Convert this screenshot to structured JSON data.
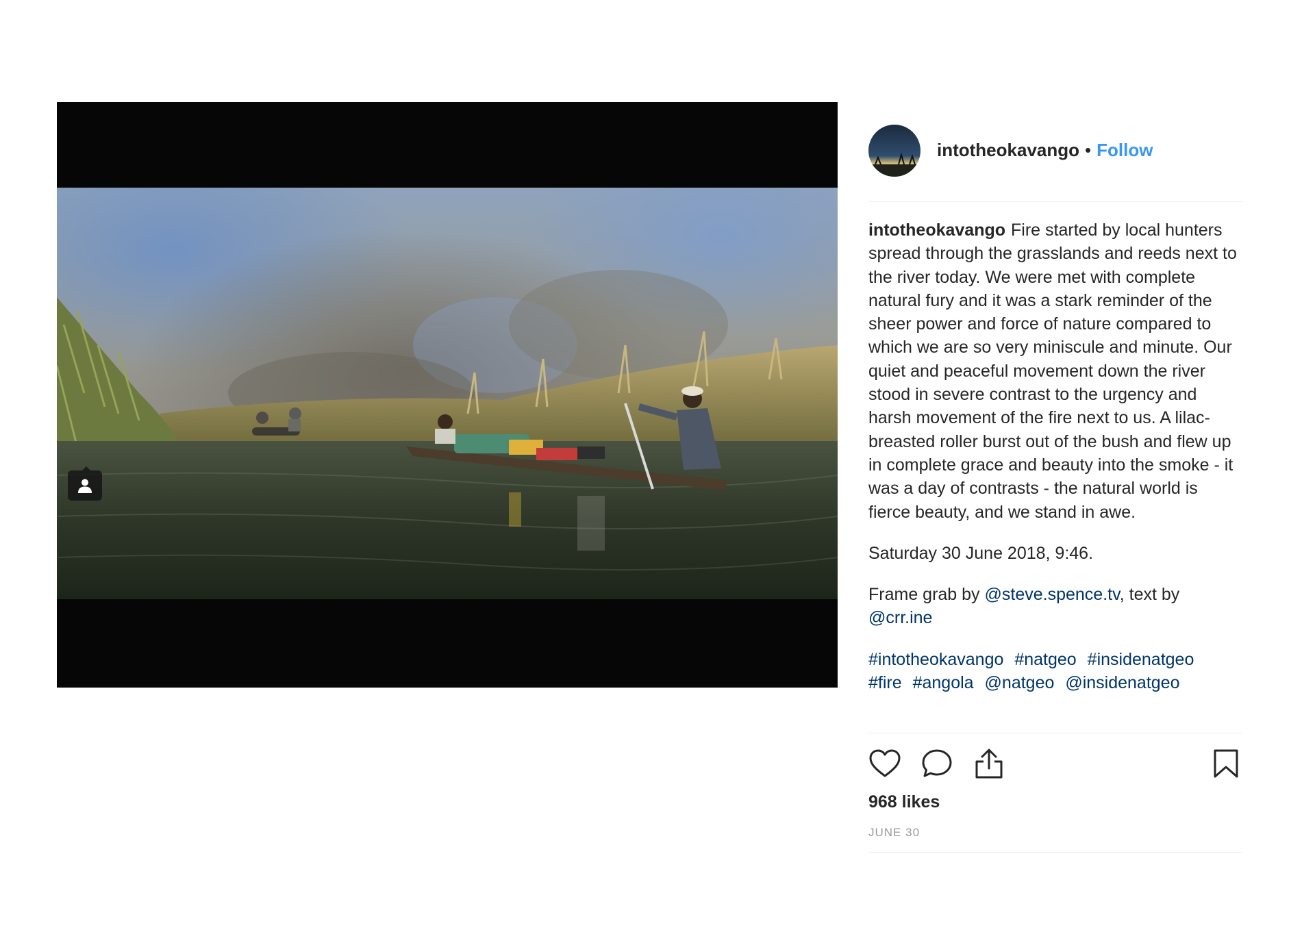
{
  "post": {
    "username": "intotheokavango",
    "separator": "•",
    "follow_label": "Follow"
  },
  "caption": {
    "author": "intotheokavango",
    "text": "Fire started by local hunters spread through the grasslands and reeds next to the river today. We were met with complete natural fury and it was a stark reminder of the sheer power and force of nature compared to which we are so very miniscule and minute. Our quiet and peaceful movement down the river stood in severe contrast to the urgency and harsh movement of the fire next to us. A lilac-breasted roller burst out of the bush and flew up in complete grace and beauty into the smoke - it was a day of contrasts - the natural world is fierce beauty, and we stand in awe.",
    "datetime": "Saturday 30 June 2018, 9:46.",
    "credit_prefix": "Frame grab by",
    "credit_photographer": "@steve.spence.tv",
    "credit_middle": ", text by",
    "credit_writer": "@crr.ine",
    "hashtags": [
      "#intotheokavango",
      "#natgeo",
      "#insidenatgeo",
      "#fire",
      "#angola",
      "@natgeo",
      "@insidenatgeo"
    ]
  },
  "stats": {
    "likes": "968 likes",
    "date": "JUNE 30"
  },
  "icons": {
    "tag": "user-tag-icon",
    "like": "heart-icon",
    "comment": "comment-bubble-icon",
    "share": "share-icon",
    "save": "bookmark-icon"
  },
  "colors": {
    "follow": "#3897f0",
    "link": "#003569",
    "text": "#262626",
    "muted": "#999999"
  }
}
